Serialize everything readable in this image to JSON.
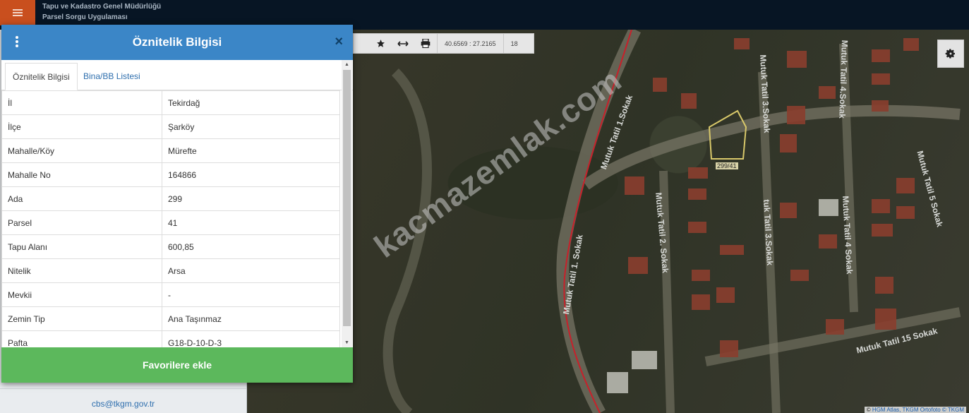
{
  "header": {
    "org_title": "Tapu ve Kadastro Genel Müdürlüğü",
    "app_title": "Parsel Sorgu Uygulaması"
  },
  "dialog": {
    "title": "Öznitelik Bilgisi",
    "close_label": "×",
    "tabs": [
      {
        "label": "Öznitelik Bilgisi",
        "active": true
      },
      {
        "label": "Bina/BB Listesi",
        "active": false
      }
    ],
    "rows": [
      {
        "key": "İl",
        "value": "Tekirdağ"
      },
      {
        "key": "İlçe",
        "value": "Şarköy"
      },
      {
        "key": "Mahalle/Köy",
        "value": "Mürefte"
      },
      {
        "key": "Mahalle No",
        "value": "164866"
      },
      {
        "key": "Ada",
        "value": "299"
      },
      {
        "key": "Parsel",
        "value": "41"
      },
      {
        "key": "Tapu Alanı",
        "value": "600,85"
      },
      {
        "key": "Nitelik",
        "value": "Arsa"
      },
      {
        "key": "Mevkii",
        "value": "-"
      },
      {
        "key": "Zemin Tip",
        "value": "Ana Taşınmaz"
      },
      {
        "key": "Pafta",
        "value": "G18-D-10-D-3"
      }
    ],
    "favorite_button": "Favorilere ekle"
  },
  "sidebar": {
    "contact_email": "cbs@tkgm.gov.tr"
  },
  "map": {
    "coords": "40.6569 : 27.2165",
    "zoom": "18",
    "parcel_label": "299/41",
    "watermark": "kacmazemlak.com",
    "streets": [
      "Mutuk Tatil 1.Sokak",
      "Mutuk Tatil 1. Sokak",
      "Mutuk Tatil 2. Sokak",
      "Mutuk Tatil 3.Sokak",
      "tuk Tatil 3.Sokak",
      "Mutuk Tatil 4.Sokak",
      "Mutuk Tatil 4 Sokak",
      "Mutuk Tatil 5 Sokak",
      "Mutuk Tatil 15 Sokak"
    ],
    "attribution_prefix": "© ",
    "attribution_links": "HGM Atlas, TKGM Ortofoto ©",
    "attribution_suffix": "TKGM"
  },
  "colors": {
    "header_bg": "#071524",
    "menu_bg": "#c94f1e",
    "dialog_header": "#3b86c7",
    "favorite_button": "#5cb85c",
    "parcel_outline": "#d8c86a",
    "boundary_line": "#c8202a"
  },
  "icons": [
    "menu-icon",
    "kebab-icon",
    "close-icon",
    "star-icon",
    "measure-icon",
    "print-icon",
    "gear-icon"
  ]
}
